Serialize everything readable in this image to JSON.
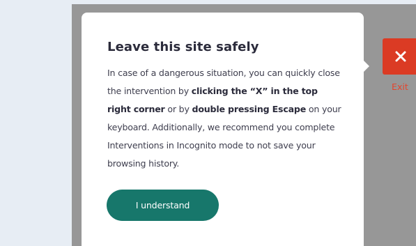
{
  "dialog": {
    "title": "Leave this site safely",
    "body": {
      "intro": "In case of a dangerous situation, you can quickly close the intervention by ",
      "bold1": "clicking the “X” in the top right corner",
      "middle": " or by ",
      "bold2": "double pressing Escape",
      "outro": " on your keyboard. Additionally, we recommend you complete Interventions in Incognito mode to not save your browsing history."
    },
    "button_label": "I understand"
  },
  "exit": {
    "icon": "close-x-icon",
    "label": "Exit"
  },
  "colors": {
    "page_background": "#e7edf4",
    "overlay": "#979797",
    "primary_button": "#17776b",
    "exit_button": "#db3b24",
    "exit_label": "#e3452d"
  }
}
